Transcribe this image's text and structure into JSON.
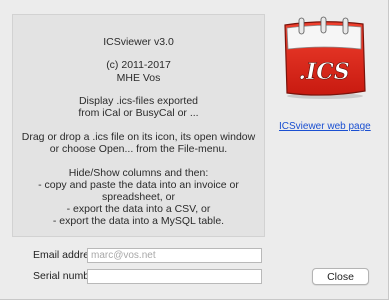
{
  "about": {
    "title_version": "ICSviewer v3.0",
    "copyright": "(c) 2011-2017",
    "author": "MHE Vos",
    "display_line1": "Display .ics-files exported",
    "display_line2": "from iCal or BusyCal or ...",
    "drag_line1": "Drag or drop a .ics file on its icon, its open window",
    "drag_line2": "or choose Open... from the File-menu.",
    "hideshow_line1": "Hide/Show columns and then:",
    "hideshow_line2": "- copy and paste the data into an invoice or",
    "hideshow_line3": "spreadsheet, or",
    "hideshow_line4": "- export the data into a CSV, or",
    "hideshow_line5": "- export the data into a MySQL table."
  },
  "icon": {
    "name": "ics-calendar-icon",
    "text": ".ICS",
    "brand_red": "#e02a1c"
  },
  "weblink": {
    "label": "ICSviewer web page",
    "color": "#1a4fd1"
  },
  "form": {
    "email_label": "Email address",
    "email_value": "",
    "email_placeholder": "marc@vos.net",
    "serial_label": "Serial number",
    "serial_value": "",
    "serial_placeholder": ""
  },
  "buttons": {
    "close_label": "Close"
  }
}
